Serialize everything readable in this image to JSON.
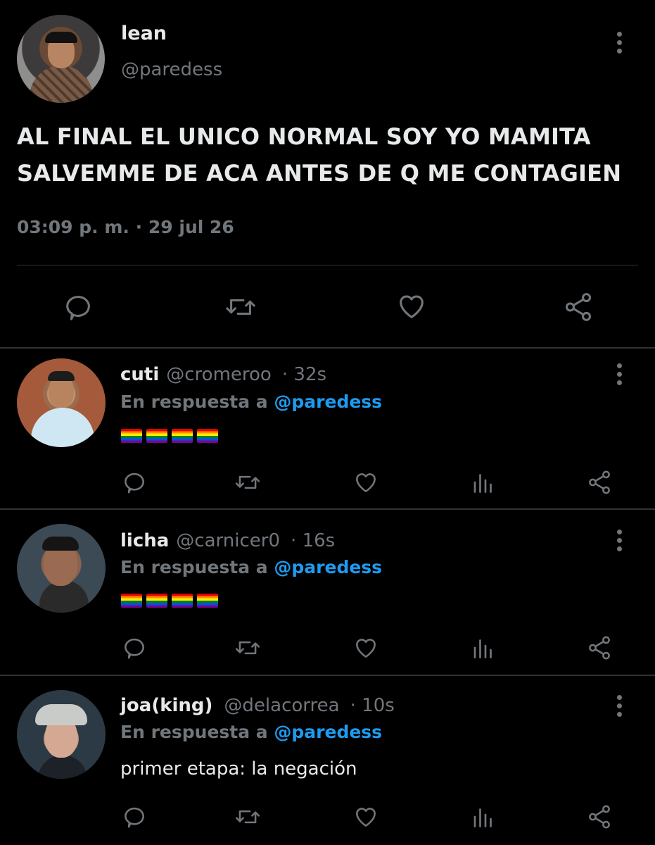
{
  "main_tweet": {
    "name": "lean",
    "handle": "@paredess",
    "text_line1": "AL FINAL EL UNICO NORMAL SOY YO MAMITA",
    "text_line2": "SALVEMME DE ACA ANTES DE Q ME CONTAGIEN",
    "time": "03:09 p. m.",
    "separator": "·",
    "date": "29 jul 26",
    "actions": [
      "reply-icon",
      "retweet-icon",
      "like-icon",
      "share-icon"
    ]
  },
  "replies": [
    {
      "name": "cuti",
      "handle": "@cromeroo",
      "time": "· 32s",
      "reply_prefix": "En respuesta a",
      "reply_to": "@paredess",
      "content_type": "flags",
      "flag_count": 4,
      "text": ""
    },
    {
      "name": "licha",
      "handle": "@carnicer0",
      "time": "· 16s",
      "reply_prefix": "En respuesta a",
      "reply_to": "@paredess",
      "content_type": "flags",
      "flag_count": 4,
      "text": ""
    },
    {
      "name": "joa(king)",
      "handle": "@delacorrea",
      "time": "· 10s",
      "reply_prefix": "En respuesta a",
      "reply_to": "@paredess",
      "content_type": "text",
      "text": "primer etapa: la negación"
    }
  ],
  "reply_actions": [
    "reply-icon",
    "retweet-icon",
    "like-icon",
    "views-icon",
    "share-icon"
  ],
  "colors": {
    "background": "#000000",
    "primary_text": "#e7e9ea",
    "secondary_text": "#71767b",
    "mention": "#1d9bf0",
    "divider": "#2f3336"
  }
}
